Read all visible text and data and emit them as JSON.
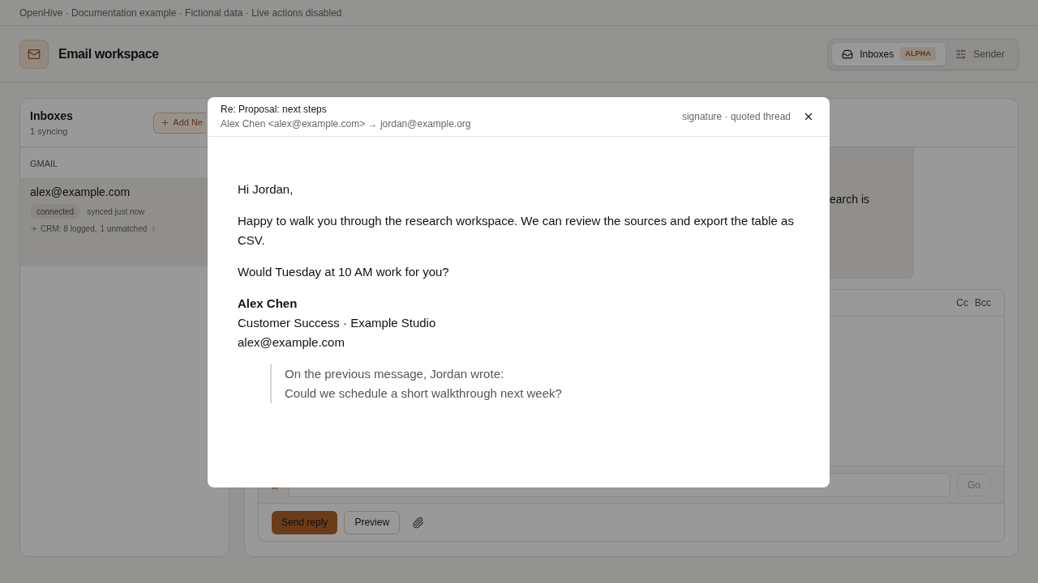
{
  "banner": "OpenHive · Documentation example · Fictional data · Live actions disabled",
  "header": {
    "title": "Email workspace",
    "tabs": [
      {
        "label": "Inboxes",
        "badge": "ALPHA",
        "selected": true
      },
      {
        "label": "Sender",
        "selected": false
      }
    ]
  },
  "inboxes": {
    "title": "Inboxes",
    "subtitle": "1 syncing",
    "add_button": "Add Ne",
    "groups": [
      {
        "label": "GMAIL",
        "accounts": [
          {
            "email": "alex@example.com",
            "status": "connected",
            "synced": "synced just now",
            "crm_logged": "CRM: 8 logged,",
            "crm_unmatched": "1 unmatched",
            "selected": true
          }
        ]
      }
    ]
  },
  "thread": {
    "preview_fragment": "earch is"
  },
  "composer": {
    "cc": "Cc",
    "bcc": "Bcc",
    "go": "Go",
    "send": "Send reply",
    "preview": "Preview"
  },
  "modal": {
    "subject": "Re: Proposal: next steps",
    "route": "Alex Chen <alex@example.com> → jordan@example.org",
    "meta": "signature · quoted thread",
    "greeting": "Hi Jordan,",
    "paragraphs": [
      "Happy to walk you through the research workspace. We can review the sources and export the table as CSV.",
      "Would Tuesday at 10 AM work for you?"
    ],
    "signature": {
      "name": "Alex Chen",
      "lines": [
        "Customer Success · Example Studio",
        "alex@example.com"
      ]
    },
    "quote": [
      "On the previous message, Jordan wrote:",
      "Could we schedule a short walkthrough next week?"
    ]
  }
}
